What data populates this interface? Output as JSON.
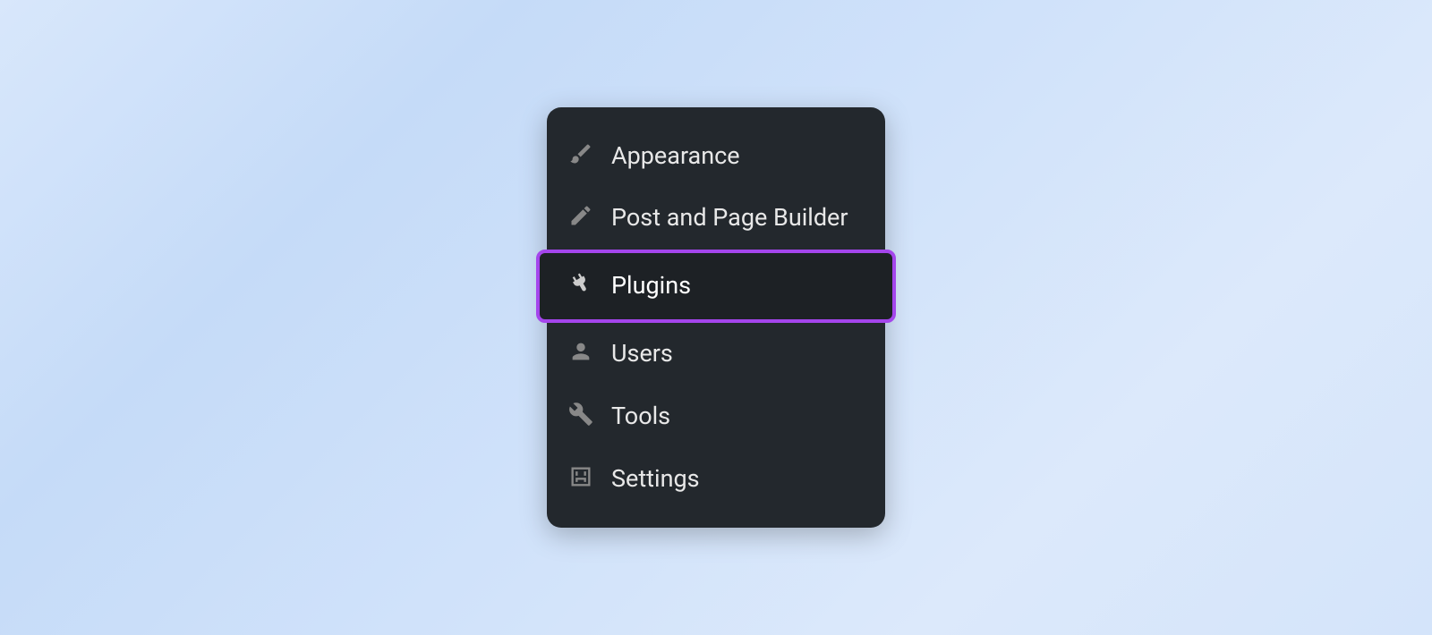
{
  "menu": {
    "items": [
      {
        "label": "Appearance",
        "icon": "brush-icon",
        "highlighted": false
      },
      {
        "label": "Post and Page Builder",
        "icon": "pencil-icon",
        "highlighted": false
      },
      {
        "label": "Plugins",
        "icon": "plug-icon",
        "highlighted": true
      },
      {
        "label": "Users",
        "icon": "user-icon",
        "highlighted": false
      },
      {
        "label": "Tools",
        "icon": "wrench-icon",
        "highlighted": false
      },
      {
        "label": "Settings",
        "icon": "sliders-icon",
        "highlighted": false
      }
    ]
  },
  "highlight_color": "#a445ec",
  "panel_bg": "#23282d"
}
